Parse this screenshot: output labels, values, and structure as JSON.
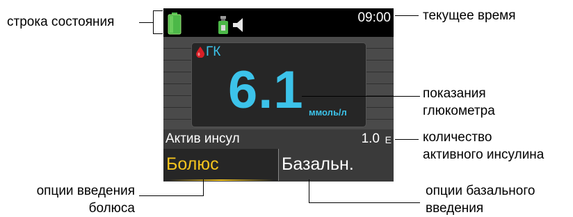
{
  "status_bar": {
    "time": "09:00",
    "icons": [
      "battery-icon",
      "insulin-vial-icon",
      "speaker-icon"
    ]
  },
  "glucose": {
    "label": "ГК",
    "value": "6.1",
    "unit": "ммоль/л",
    "icon": "blood-drop-icon"
  },
  "active_insulin": {
    "label": "Актив инсул",
    "value": "1.0",
    "unit": "Е"
  },
  "tabs": {
    "bolus": "Болюс",
    "basal": "Базальн."
  },
  "callouts": {
    "status_bar": "строка состояния",
    "current_time": "текущее время",
    "bg_reading_1": "показания",
    "bg_reading_2": "глюкометра",
    "active_insulin_1": "количество",
    "active_insulin_2": "активного инсулина",
    "bolus_options_1": "опции введения",
    "bolus_options_2": "болюса",
    "basal_options_1": "опции базального",
    "basal_options_2": "введения"
  },
  "colors": {
    "accent_blue": "#3cc3ea",
    "accent_yellow": "#f3c31d",
    "battery_green": "#4cb848",
    "drop_red": "#d81f26"
  }
}
